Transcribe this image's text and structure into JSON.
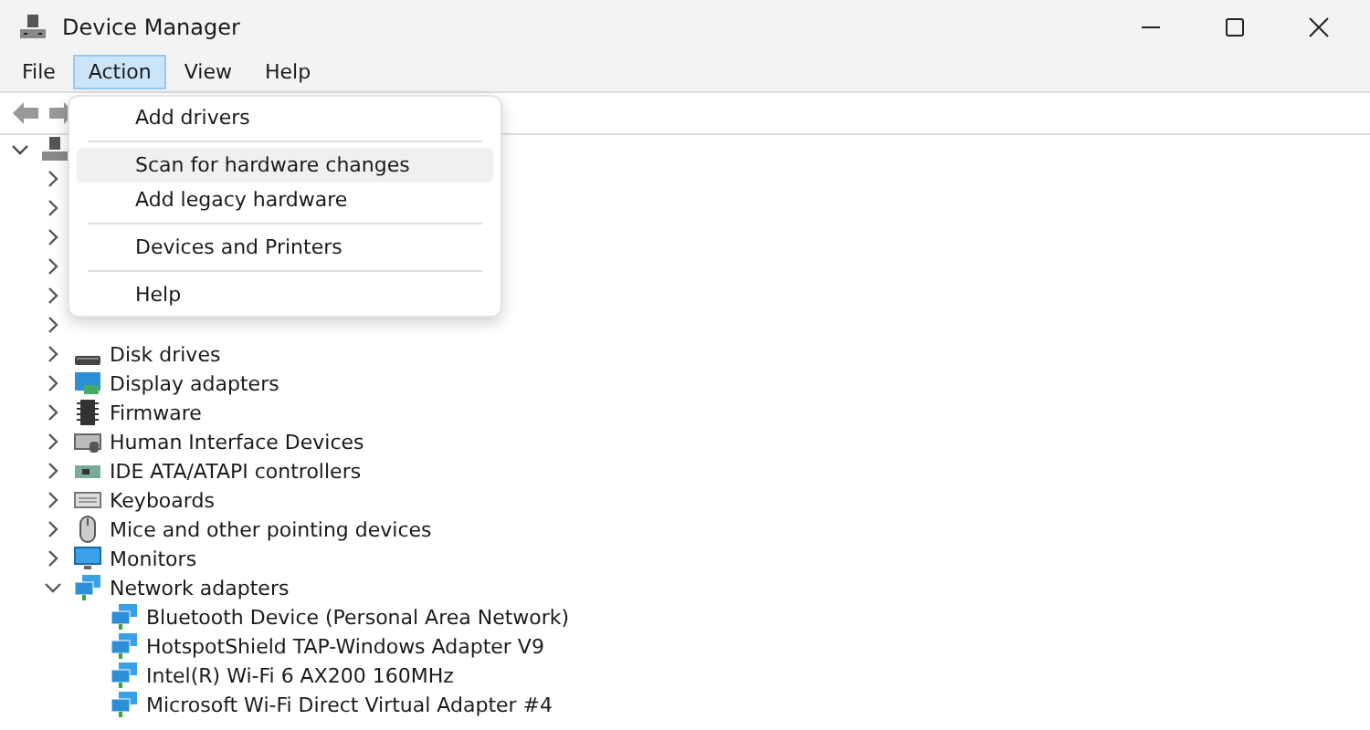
{
  "window": {
    "title": "Device Manager"
  },
  "menu_bar": [
    {
      "label": "File",
      "selected": false
    },
    {
      "label": "Action",
      "selected": true
    },
    {
      "label": "View",
      "selected": false
    },
    {
      "label": "Help",
      "selected": false
    }
  ],
  "action_menu": [
    {
      "kind": "item",
      "label": "Add drivers",
      "selected": false
    },
    {
      "kind": "separator"
    },
    {
      "kind": "item",
      "label": "Scan for hardware changes",
      "selected": true
    },
    {
      "kind": "item",
      "label": "Add legacy hardware",
      "selected": false
    },
    {
      "kind": "separator"
    },
    {
      "kind": "item",
      "label": "Devices and Printers",
      "selected": false
    },
    {
      "kind": "separator"
    },
    {
      "kind": "item",
      "label": "Help",
      "selected": false
    }
  ],
  "tree": [
    {
      "expanded": true,
      "children": [
        {
          "expanded": false
        },
        {
          "expanded": false
        },
        {
          "expanded": false
        },
        {
          "expanded": false
        },
        {
          "expanded": false
        },
        {
          "expanded": false
        },
        {
          "label": "Disk drives",
          "expanded": false
        },
        {
          "label": "Display adapters",
          "expanded": false
        },
        {
          "label": "Firmware",
          "expanded": false
        },
        {
          "label": "Human Interface Devices",
          "expanded": false
        },
        {
          "label": "IDE ATA/ATAPI controllers",
          "expanded": false
        },
        {
          "label": "Keyboards",
          "expanded": false
        },
        {
          "label": "Mice and other pointing devices",
          "expanded": false
        },
        {
          "label": "Monitors",
          "expanded": false
        },
        {
          "label": "Network adapters",
          "expanded": true,
          "children": [
            {
              "label": "Bluetooth Device (Personal Area Network)"
            },
            {
              "label": "HotspotShield TAP-Windows Adapter V9"
            },
            {
              "label": "Intel(R) Wi-Fi 6 AX200 160MHz"
            },
            {
              "label": "Microsoft Wi-Fi Direct Virtual Adapter #4"
            }
          ]
        }
      ]
    }
  ]
}
